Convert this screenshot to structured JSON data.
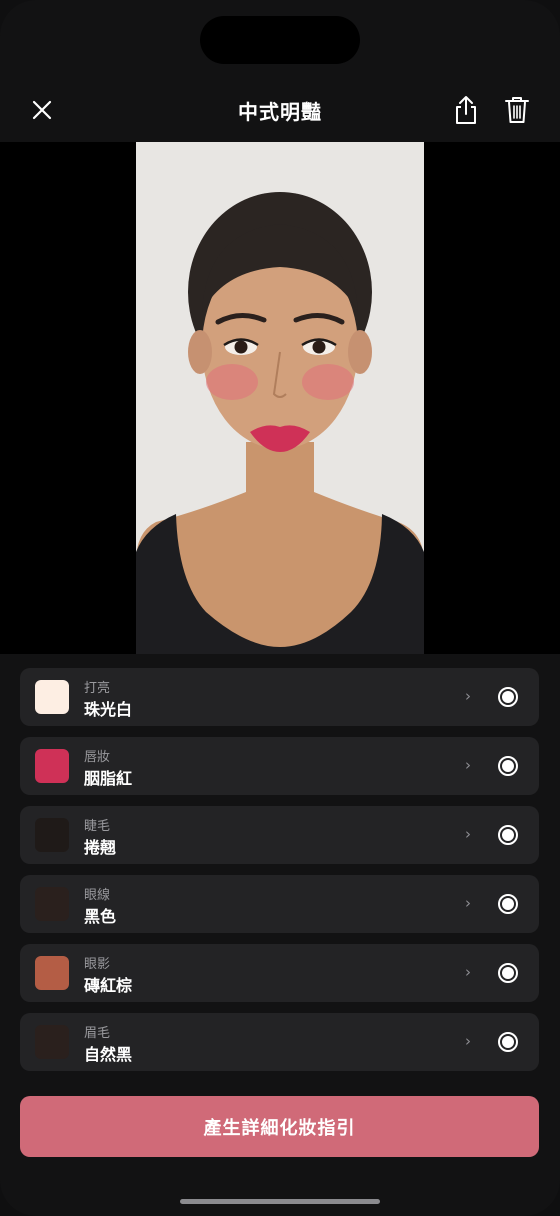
{
  "header": {
    "title": "中式明豔",
    "close_icon": "close-icon",
    "share_icon": "share-icon",
    "delete_icon": "trash-icon"
  },
  "photo": {
    "alt": ""
  },
  "items": [
    {
      "category": "打亮",
      "value": "珠光白",
      "color": "#fdeee3",
      "selected": true
    },
    {
      "category": "唇妝",
      "value": "胭脂紅",
      "color": "#cf3157",
      "selected": true
    },
    {
      "category": "睫毛",
      "value": "捲翹",
      "color": "#1f1a18",
      "selected": true
    },
    {
      "category": "眼線",
      "value": "黑色",
      "color": "#2a201d",
      "selected": true
    },
    {
      "category": "眼影",
      "value": "磚紅棕",
      "color": "#b45d45",
      "selected": true
    },
    {
      "category": "眉毛",
      "value": "自然黑",
      "color": "#2a201d",
      "selected": true
    }
  ],
  "chevron": "›",
  "cta": {
    "label": "產生詳細化妝指引"
  },
  "colors": {
    "accent": "#d06a78",
    "row_bg": "#232325",
    "app_bg": "#121213"
  }
}
